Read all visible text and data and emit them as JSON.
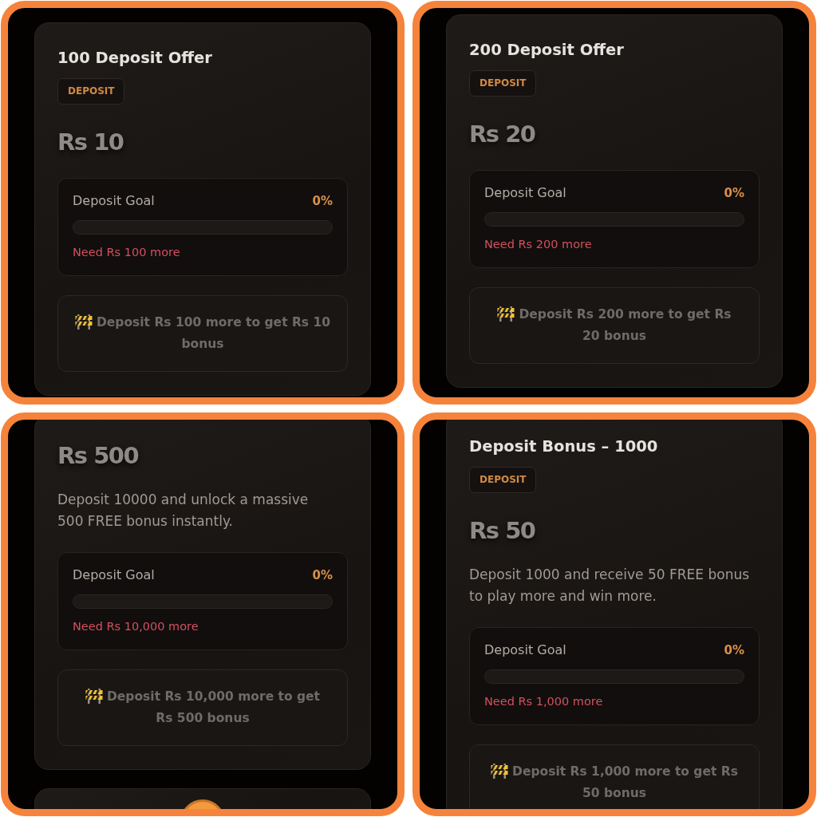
{
  "panels": [
    {
      "cards": [
        {
          "kind": "offer",
          "title": "100 Deposit Offer",
          "tag": "DEPOSIT",
          "amount": "Rs 10",
          "goal": {
            "label": "Deposit Goal",
            "percent": "0%",
            "level": 0,
            "need": "Need Rs 100 more"
          },
          "status": "Deposit Rs 100 more to get Rs 10\nbonus"
        }
      ]
    },
    {
      "cards": [
        {
          "kind": "offer",
          "title": "200 Deposit Offer",
          "tag": "DEPOSIT",
          "amount": "Rs 20",
          "goal": {
            "label": "Deposit Goal",
            "percent": "0%",
            "level": 0,
            "need": "Need Rs 200 more"
          },
          "status": "Deposit Rs 200 more to get Rs\n20 bonus"
        }
      ]
    },
    {
      "cards": [
        {
          "kind": "offer",
          "amount": "Rs 500",
          "description": "Deposit 10000 and unlock a massive\n500 FREE bonus instantly.",
          "goal": {
            "label": "Deposit Goal",
            "percent": "0%",
            "level": 0,
            "need": "Need Rs 10,000 more"
          },
          "status": "Deposit Rs 10,000 more to get\nRs 500 bonus"
        },
        {
          "kind": "icon_header"
        }
      ]
    },
    {
      "cards": [
        {
          "kind": "offer",
          "title": "Deposit Bonus – 1000",
          "tag": "DEPOSIT",
          "amount": "Rs 50",
          "description": "Deposit 1000 and receive 50 FREE bonus\nto play more and win more.",
          "goal": {
            "label": "Deposit Goal",
            "percent": "0%",
            "level": 0,
            "need": "Need Rs 1,000 more"
          },
          "status": "Deposit Rs 1,000 more to get Rs\n50 bonus"
        }
      ]
    }
  ]
}
